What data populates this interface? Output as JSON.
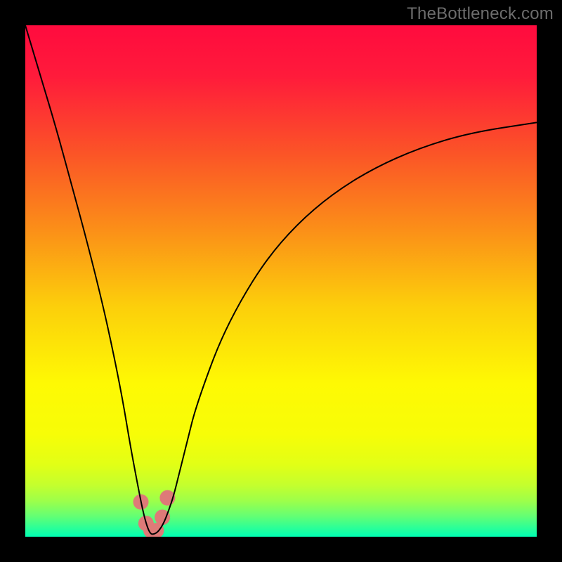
{
  "watermark": "TheBottleneck.com",
  "chart_data": {
    "type": "line",
    "title": "",
    "xlabel": "",
    "ylabel": "",
    "xlim": [
      0,
      100
    ],
    "ylim": [
      0,
      100
    ],
    "grid": false,
    "background_gradient": {
      "stops": [
        {
          "offset": 0.0,
          "color": "#ff0b3e"
        },
        {
          "offset": 0.1,
          "color": "#ff1b3b"
        },
        {
          "offset": 0.25,
          "color": "#fb5427"
        },
        {
          "offset": 0.4,
          "color": "#fb8f18"
        },
        {
          "offset": 0.55,
          "color": "#fccf0b"
        },
        {
          "offset": 0.7,
          "color": "#fef904"
        },
        {
          "offset": 0.8,
          "color": "#f7fd07"
        },
        {
          "offset": 0.86,
          "color": "#e1ff16"
        },
        {
          "offset": 0.9,
          "color": "#c3ff2e"
        },
        {
          "offset": 0.93,
          "color": "#9dff4a"
        },
        {
          "offset": 0.96,
          "color": "#63ff74"
        },
        {
          "offset": 1.0,
          "color": "#00ffb3"
        }
      ]
    },
    "series": [
      {
        "name": "bottleneck-curve",
        "stroke": "#000000",
        "stroke_width": 2,
        "x": [
          0,
          3,
          6,
          9,
          12,
          15,
          17,
          19,
          20.5,
          22,
          23,
          23.8,
          24.5,
          25.2,
          26,
          27,
          28,
          29,
          30,
          31,
          32,
          33,
          35,
          38,
          42,
          47,
          53,
          60,
          68,
          77,
          87,
          100
        ],
        "y": [
          100,
          90,
          80,
          69,
          58,
          46,
          37,
          27,
          18,
          10,
          5,
          2,
          0.5,
          0.5,
          1,
          2.5,
          5,
          8,
          12,
          16,
          20,
          24,
          30,
          38,
          46,
          54,
          61,
          67,
          72,
          76,
          79,
          81
        ]
      }
    ],
    "markers": {
      "name": "minimum-cluster",
      "fill": "#de7a78",
      "radius_px": 11,
      "points": [
        {
          "x": 22.6,
          "y": 6.8
        },
        {
          "x": 23.6,
          "y": 2.6
        },
        {
          "x": 24.6,
          "y": 1.2
        },
        {
          "x": 25.6,
          "y": 1.2
        },
        {
          "x": 26.8,
          "y": 3.8
        },
        {
          "x": 27.8,
          "y": 7.6
        }
      ]
    }
  }
}
